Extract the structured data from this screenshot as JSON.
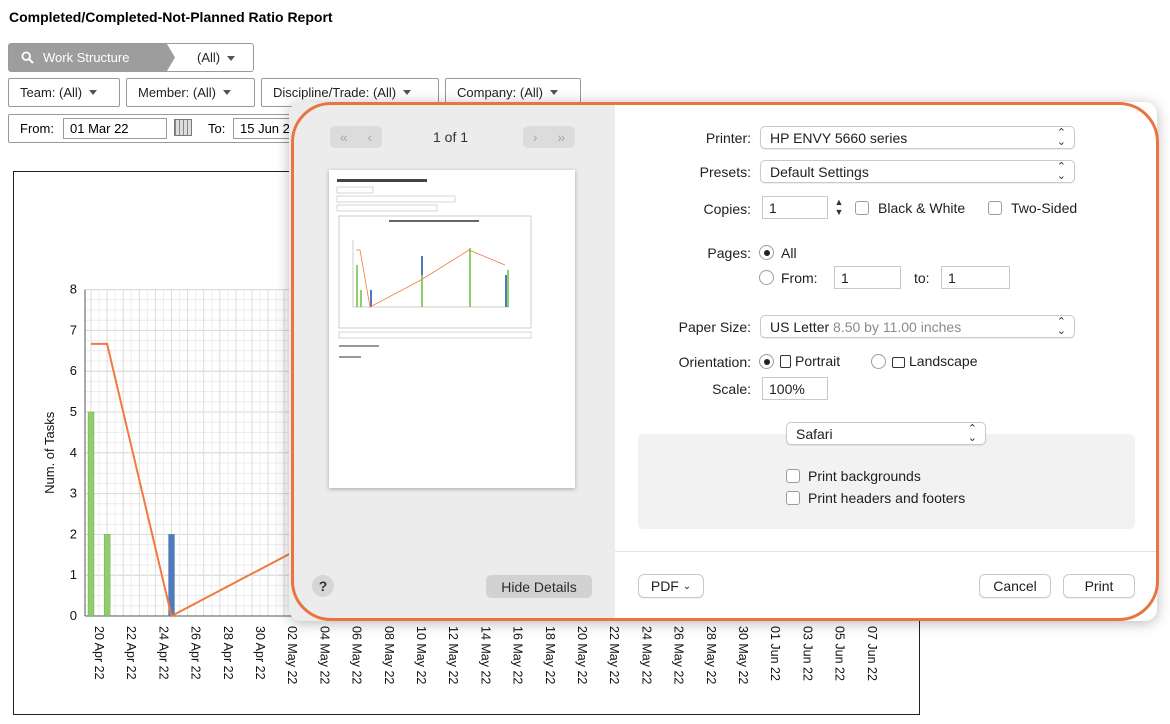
{
  "report": {
    "title": "Completed/Completed-Not-Planned Ratio Report",
    "work_structure_label": "Work Structure",
    "work_structure_value": "(All)",
    "filters": {
      "team": "Team: (All)",
      "member": "Member: (All)",
      "discipline": "Discipline/Trade: (All)",
      "company": "Company: (All)"
    },
    "from_label": "From:",
    "from_value": "01 Mar 22",
    "to_label": "To:",
    "to_value": "15 Jun 2"
  },
  "chart_data": {
    "type": "bar",
    "ylabel": "Num. of Tasks",
    "ylim": [
      0,
      8
    ],
    "y_ticks": [
      0,
      1,
      2,
      3,
      4,
      5,
      6,
      7,
      8
    ],
    "x_tick_labels": [
      "20 Apr 22",
      "22 Apr 22",
      "24 Apr 22",
      "26 Apr 22",
      "28 Apr 22",
      "30 Apr 22",
      "02 May 22",
      "04 May 22",
      "06 May 22",
      "08 May 22",
      "10 May 22",
      "12 May 22",
      "14 May 22",
      "16 May 22",
      "18 May 22",
      "20 May 22",
      "22 May 22",
      "24 May 22",
      "26 May 22",
      "28 May 22",
      "30 May 22",
      "01 Jun 22",
      "03 Jun 22",
      "05 Jun 22",
      "07 Jun 22"
    ],
    "series": [
      {
        "kind": "bar",
        "color": "#8fcf6a",
        "points": [
          {
            "x": "20 Apr 22",
            "y": 5
          },
          {
            "x": "21 Apr 22",
            "y": 2
          }
        ]
      },
      {
        "kind": "bar",
        "color": "#4f79c7",
        "points": [
          {
            "x": "25 Apr 22",
            "y": 2
          }
        ]
      },
      {
        "kind": "line",
        "color": "#f07a3f",
        "points": [
          {
            "x": "20 Apr 22",
            "y": 6.67
          },
          {
            "x": "21 Apr 22",
            "y": 6.67
          },
          {
            "x": "25 Apr 22",
            "y": 0
          },
          {
            "x": "08 May 22",
            "y": 2.7
          }
        ]
      }
    ]
  },
  "print_dialog": {
    "page_indicator": "1 of 1",
    "nav_first": "«",
    "nav_prev": "‹",
    "nav_next": "›",
    "nav_last": "»",
    "help": "?",
    "hide_details": "Hide Details",
    "printer_label": "Printer:",
    "printer_value": "HP ENVY 5660 series",
    "presets_label": "Presets:",
    "presets_value": "Default Settings",
    "copies_label": "Copies:",
    "copies_value": "1",
    "black_white": "Black & White",
    "two_sided": "Two-Sided",
    "pages_label": "Pages:",
    "pages_all": "All",
    "pages_from": "From:",
    "pages_from_value": "1",
    "pages_to": "to:",
    "pages_to_value": "1",
    "paper_size_label": "Paper Size:",
    "paper_size_value": "US Letter",
    "paper_size_detail": "8.50 by 11.00 inches",
    "orientation_label": "Orientation:",
    "portrait": "Portrait",
    "landscape": "Landscape",
    "scale_label": "Scale:",
    "scale_value": "100%",
    "app_section": "Safari",
    "print_backgrounds": "Print backgrounds",
    "print_headers": "Print headers and footers",
    "pdf": "PDF",
    "cancel": "Cancel",
    "print": "Print"
  }
}
